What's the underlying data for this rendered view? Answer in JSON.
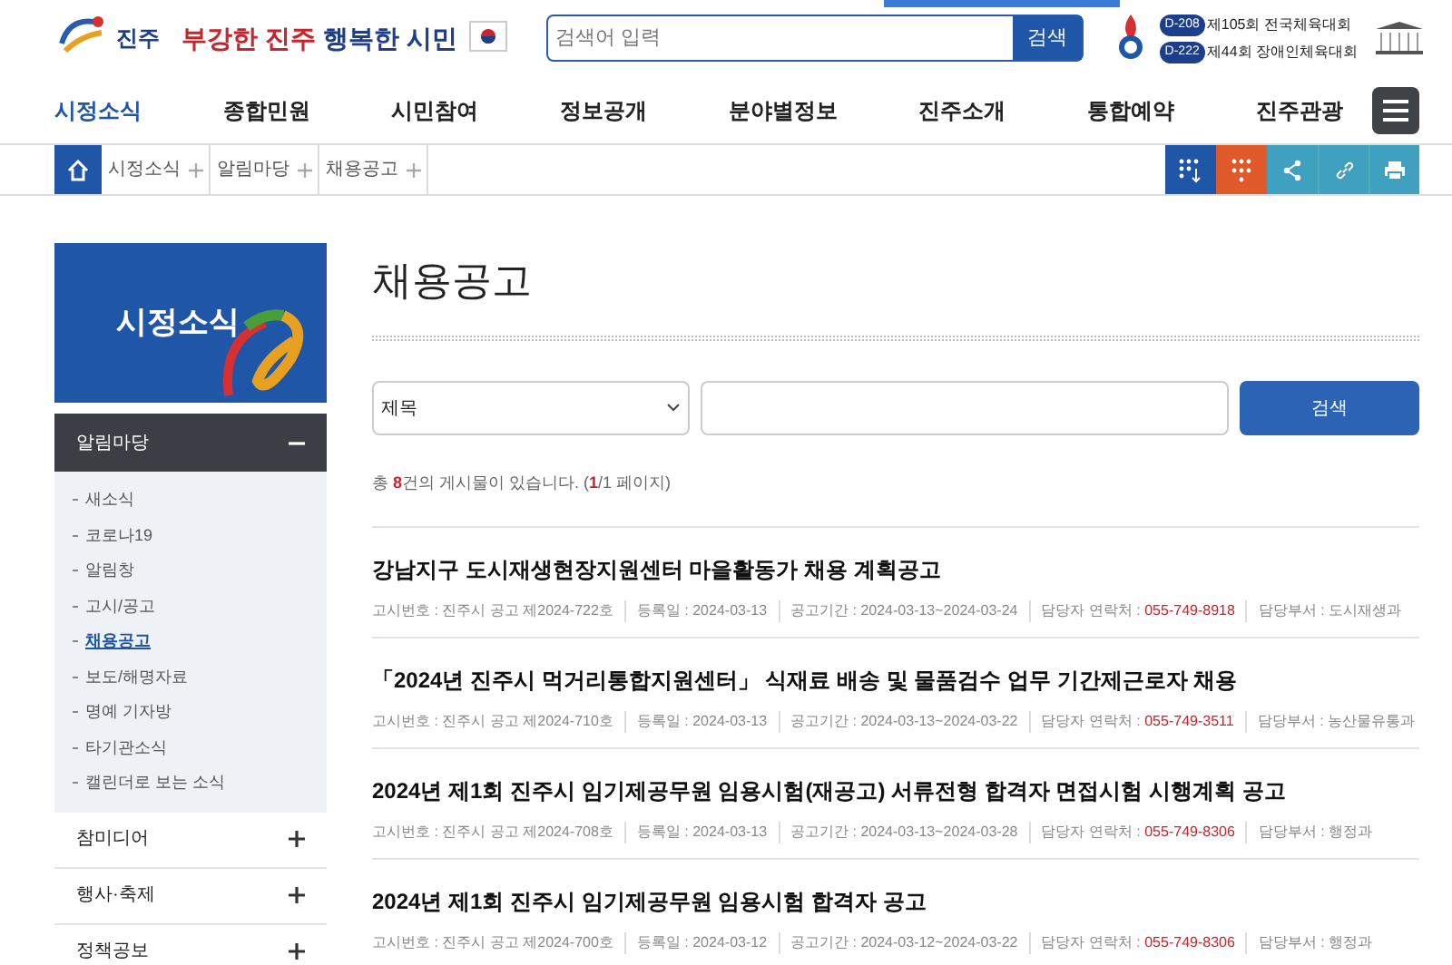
{
  "header": {
    "slogan_red": "부강한 진주",
    "slogan_blue": "행복한 시민",
    "logo_text": "진주",
    "search": {
      "placeholder": "검색어 입력",
      "button": "검색"
    },
    "events": [
      {
        "badge": "D-208",
        "text": "제105회 전국체육대회"
      },
      {
        "badge": "D-222",
        "text": "제44회 장애인체육대회"
      }
    ]
  },
  "nav": [
    {
      "label": "시정소식",
      "selected": true
    },
    {
      "label": "종합민원",
      "selected": false
    },
    {
      "label": "시민참여",
      "selected": false
    },
    {
      "label": "정보공개",
      "selected": false
    },
    {
      "label": "분야별정보",
      "selected": false
    },
    {
      "label": "진주소개",
      "selected": false
    },
    {
      "label": "통합예약",
      "selected": false
    },
    {
      "label": "진주관광",
      "selected": false
    }
  ],
  "breadcrumb": [
    "시정소식",
    "알림마당",
    "채용공고"
  ],
  "sidebar": {
    "title": "시정소식",
    "groups": [
      {
        "label": "알림마당",
        "expanded": true,
        "items": [
          {
            "label": "새소식",
            "selected": false
          },
          {
            "label": "코로나19",
            "selected": false
          },
          {
            "label": "알림창",
            "selected": false
          },
          {
            "label": "고시/공고",
            "selected": false
          },
          {
            "label": "채용공고",
            "selected": true
          },
          {
            "label": "보도/해명자료",
            "selected": false
          },
          {
            "label": "명예 기자방",
            "selected": false
          },
          {
            "label": "타기관소식",
            "selected": false
          },
          {
            "label": "캘린더로 보는 소식",
            "selected": false
          }
        ]
      },
      {
        "label": "참미디어",
        "expanded": false
      },
      {
        "label": "행사·축제",
        "expanded": false
      },
      {
        "label": "정책공보",
        "expanded": false
      }
    ]
  },
  "page_title": "채용공고",
  "filter": {
    "select": "제목",
    "button": "검색"
  },
  "count": {
    "prefix": "총 ",
    "total": "8",
    "middle": "건의 게시물이 있습니다. (",
    "page": "1",
    "suffix": "/1 페이지)"
  },
  "posts": [
    {
      "title": "강남지구 도시재생현장지원센터 마을활동가 채용 계획공고",
      "meta": [
        {
          "label": "고시번호 :",
          "value": "진주시 공고 제2024-722호",
          "highlight": false
        },
        {
          "label": "등록일 :",
          "value": "2024-03-13",
          "highlight": false
        },
        {
          "label": "공고기간 :",
          "value": "2024-03-13~2024-03-24",
          "highlight": false
        },
        {
          "label": "담당자 연락처 :",
          "value": "055-749-8918",
          "highlight": true
        },
        {
          "label": "담당부서 :",
          "value": "도시재생과",
          "highlight": false
        }
      ]
    },
    {
      "title": "「2024년 진주시 먹거리통합지원센터」 식재료 배송 및 물품검수 업무 기간제근로자 채용",
      "meta": [
        {
          "label": "고시번호 :",
          "value": "진주시 공고 제2024-710호",
          "highlight": false
        },
        {
          "label": "등록일 :",
          "value": "2024-03-13",
          "highlight": false
        },
        {
          "label": "공고기간 :",
          "value": "2024-03-13~2024-03-22",
          "highlight": false
        },
        {
          "label": "담당자 연락처 :",
          "value": "055-749-3511",
          "highlight": true
        },
        {
          "label": "담당부서 :",
          "value": "농산물유통과",
          "highlight": false
        }
      ]
    },
    {
      "title": "2024년 제1회 진주시 임기제공무원 임용시험(재공고) 서류전형 합격자 면접시험 시행계획 공고",
      "meta": [
        {
          "label": "고시번호 :",
          "value": "진주시 공고 제2024-708호",
          "highlight": false
        },
        {
          "label": "등록일 :",
          "value": "2024-03-13",
          "highlight": false
        },
        {
          "label": "공고기간 :",
          "value": "2024-03-13~2024-03-28",
          "highlight": false
        },
        {
          "label": "담당자 연락처 :",
          "value": "055-749-8306",
          "highlight": true
        },
        {
          "label": "담당부서 :",
          "value": "행정과",
          "highlight": false
        }
      ]
    },
    {
      "title": "2024년 제1회 진주시 임기제공무원 임용시험 합격자 공고",
      "meta": [
        {
          "label": "고시번호 :",
          "value": "진주시 공고 제2024-700호",
          "highlight": false
        },
        {
          "label": "등록일 :",
          "value": "2024-03-12",
          "highlight": false
        },
        {
          "label": "공고기간 :",
          "value": "2024-03-12~2024-03-22",
          "highlight": false
        },
        {
          "label": "담당자 연락처 :",
          "value": "055-749-8306",
          "highlight": true
        },
        {
          "label": "담당부서 :",
          "value": "행정과",
          "highlight": false
        }
      ]
    }
  ]
}
